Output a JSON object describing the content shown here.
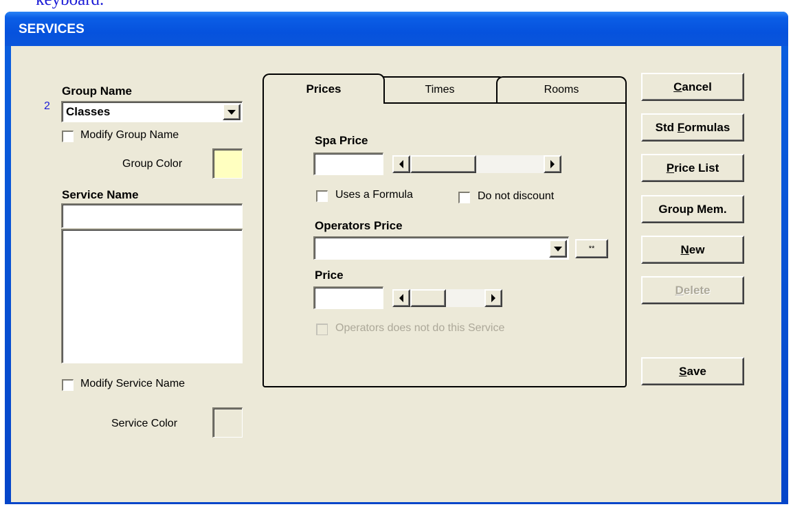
{
  "page_top_text": "keyboard.",
  "window": {
    "title": "SERVICES"
  },
  "left": {
    "group_index": "2",
    "group_name_label": "Group Name",
    "group_name_value": "Classes",
    "modify_group_label": "Modify Group Name",
    "group_color_label": "Group Color",
    "group_color": "#ffffc0",
    "service_name_label": "Service Name",
    "service_name_value": "",
    "modify_service_label": "Modify Service Name",
    "service_color_label": "Service Color",
    "service_color": "#ece9d8"
  },
  "tabs": [
    {
      "label": "Prices",
      "active": true
    },
    {
      "label": "Times",
      "active": false
    },
    {
      "label": "Rooms",
      "active": false
    }
  ],
  "prices": {
    "spa_price_label": "Spa Price",
    "spa_price_value": "",
    "uses_formula_label": "Uses a Formula",
    "do_not_discount_label": "Do not discount",
    "operators_price_label": "Operators Price",
    "operators_price_value": "",
    "ellipsis_button_label": "**",
    "price_label": "Price",
    "price_value": "",
    "operators_not_do_label": "Operators does not do this Service"
  },
  "buttons": {
    "cancel": {
      "pre": "",
      "key": "C",
      "post": "ancel"
    },
    "std_formulas": {
      "pre": "Std ",
      "key": "F",
      "post": "ormulas"
    },
    "price_list": {
      "pre": "",
      "key": "P",
      "post": "rice List"
    },
    "group_mem": {
      "pre": "Group Mem.",
      "key": "",
      "post": ""
    },
    "new": {
      "pre": "",
      "key": "N",
      "post": "ew"
    },
    "delete": {
      "pre": "",
      "key": "D",
      "post": "elete"
    },
    "save": {
      "pre": "",
      "key": "S",
      "post": "ave"
    }
  }
}
